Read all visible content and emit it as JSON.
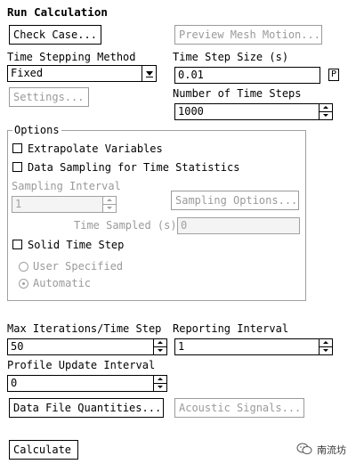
{
  "panel": {
    "title": "Run Calculation",
    "check_case": "Check Case...",
    "preview_mesh_motion": "Preview Mesh Motion...",
    "time_stepping_method": {
      "label": "Time Stepping Method",
      "value": "Fixed"
    },
    "settings": "Settings...",
    "time_step_size": {
      "label": "Time Step Size (s)",
      "value": "0.01",
      "p_button": "P"
    },
    "number_of_time_steps": {
      "label": "Number of Time Steps",
      "value": "1000"
    },
    "options": {
      "legend": "Options",
      "extrapolate_variables": "Extrapolate Variables",
      "data_sampling": "Data Sampling for Time Statistics",
      "sampling_interval_label": "Sampling Interval",
      "sampling_interval_value": "1",
      "sampling_options": "Sampling Options...",
      "time_sampled_label": "Time Sampled (s)",
      "time_sampled_value": "0",
      "solid_time_step": "Solid Time Step",
      "user_specified": "User Specified",
      "automatic": "Automatic"
    },
    "max_iterations": {
      "label": "Max Iterations/Time Step",
      "value": "50"
    },
    "reporting_interval": {
      "label": "Reporting Interval",
      "value": "1"
    },
    "profile_update_interval": {
      "label": "Profile Update Interval",
      "value": "0"
    },
    "data_file_quantities": "Data File Quantities...",
    "acoustic_signals": "Acoustic Signals...",
    "calculate": "Calculate"
  },
  "watermark": {
    "icon": "wechat-icon",
    "text": "南流坊"
  }
}
